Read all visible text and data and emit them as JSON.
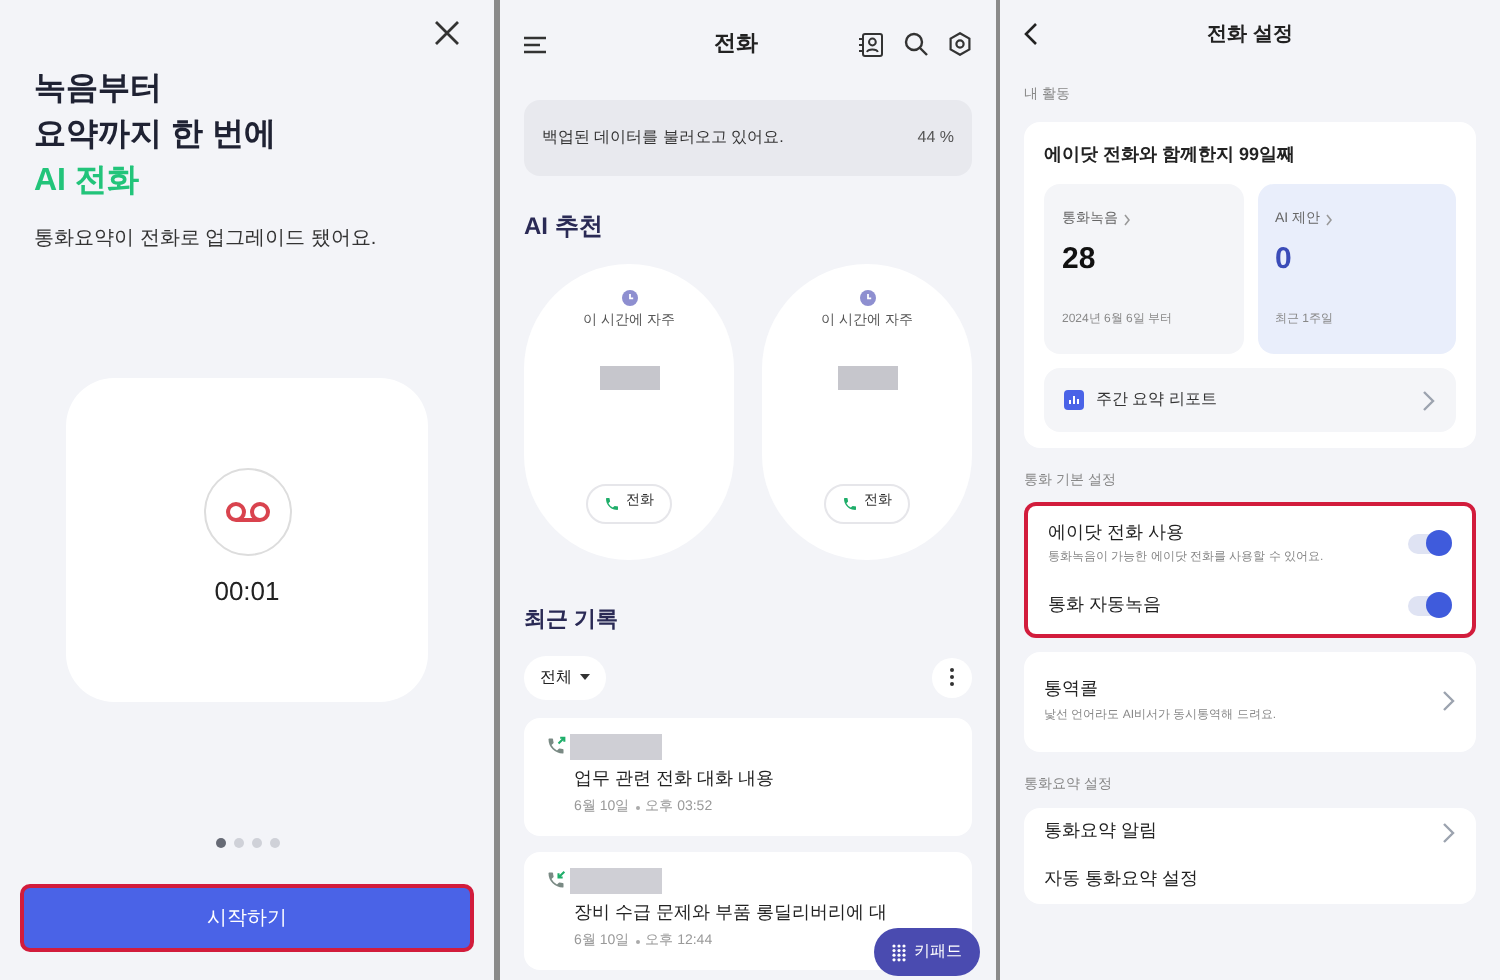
{
  "intro_panel": {
    "headline": [
      "녹음부터",
      "요약까지 한 번에"
    ],
    "highlight": "AI 전화",
    "subtitle": "통화요약이 전화로 업그레이드 됐어요.",
    "timer": "00:01",
    "page_dots": [
      {
        "selected": true
      },
      {
        "selected": false
      },
      {
        "selected": false
      },
      {
        "selected": false
      }
    ],
    "start_button": {
      "label": "시작하기",
      "highlighted": true
    }
  },
  "calls_panel": {
    "title": "전화",
    "backup_banner": {
      "text": "백업된 데이터를 불러오고 있어요.",
      "percent": "44 %"
    },
    "ai_section_title": "AI 추천",
    "recommendations": [
      {
        "caption": "이 시간에 자주",
        "call_label": "전화"
      },
      {
        "caption": "이 시간에 자주",
        "call_label": "전화"
      }
    ],
    "recent_title": "최근 기록",
    "filter": "전체",
    "records": [
      {
        "kind": "outgoing",
        "title": "업무 관련 전화 대화 내용",
        "date": "6월 10일",
        "time": "오후 03:52"
      },
      {
        "kind": "incoming",
        "title": "장비 수급 문제와 부품 롱딜리버리에 대",
        "date": "6월 10일",
        "time": "오후 12:44"
      }
    ],
    "keypad_button": "키패드"
  },
  "settings_panel": {
    "title": "전화 설정",
    "activity_label": "내 활동",
    "days_text": "에이닷 전화와 함께한지 99일째",
    "stats": [
      {
        "label": "통화녹음",
        "value": "28",
        "note": "2024년 6월 6일 부터",
        "accent": false
      },
      {
        "label": "AI 제안",
        "value": "0",
        "note": "최근 1주일",
        "accent": true
      }
    ],
    "report_label": "주간 요약 리포트",
    "basic_label": "통화 기본 설정",
    "toggles_highlighted": true,
    "toggles": [
      {
        "label": "에이닷 전화 사용",
        "description": "통화녹음이 가능한 에이닷 전화를 사용할 수 있어요.",
        "on": true
      },
      {
        "label": "통화 자동녹음",
        "on": true
      }
    ],
    "interpret": {
      "label": "통역콜",
      "description": "낯선 언어라도 AI비서가 동시통역해 드려요."
    },
    "summary_label": "통화요약 설정",
    "summary_items": [
      "통화요약 알림",
      "자동 통화요약 설정"
    ]
  }
}
